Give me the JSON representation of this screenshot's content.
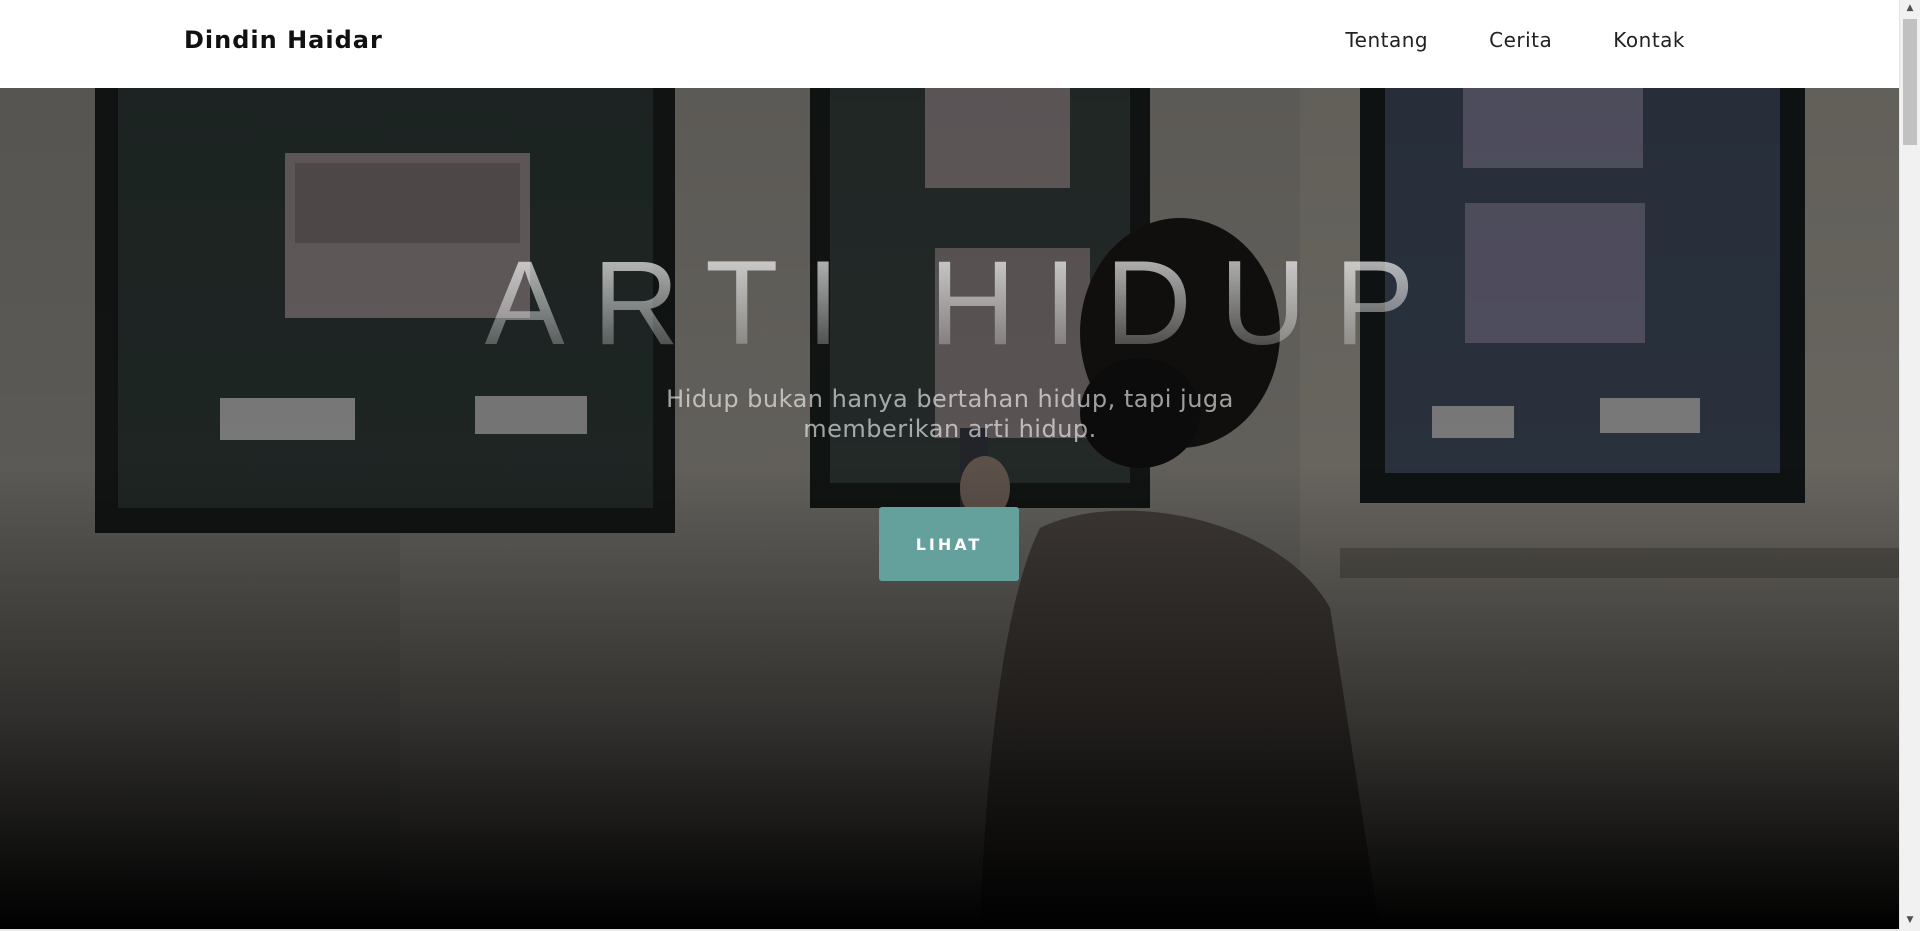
{
  "navbar": {
    "brand": "Dindin Haidar",
    "links": [
      {
        "label": "Tentang"
      },
      {
        "label": "Cerita"
      },
      {
        "label": "Kontak"
      }
    ]
  },
  "hero": {
    "title": "ARTI HIDUP",
    "subtitle": "Hidup bukan hanya bertahan hidup, tapi juga memberikan arti hidup.",
    "button_label": "LIHAT",
    "photo": "person-with-mask-photographing-framed-pictures"
  },
  "colors": {
    "accent": "#64a19d",
    "navbar_bg": "#ffffff",
    "text_dark": "#111111"
  }
}
